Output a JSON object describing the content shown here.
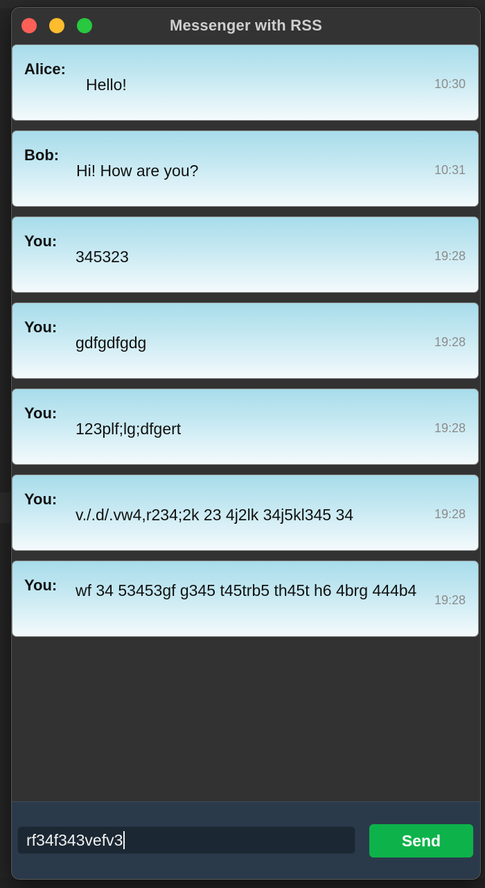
{
  "window": {
    "title": "Messenger with RSS"
  },
  "messages": [
    {
      "sender": "Alice:",
      "text": "Hello!",
      "time": "10:30"
    },
    {
      "sender": "Bob:",
      "text": "Hi! How are you?",
      "time": "10:31"
    },
    {
      "sender": "You:",
      "text": "345323",
      "time": "19:28"
    },
    {
      "sender": "You:",
      "text": "gdfgdfgdg",
      "time": "19:28"
    },
    {
      "sender": "You:",
      "text": "123plf;lg;dfgert",
      "time": "19:28"
    },
    {
      "sender": "You:",
      "text": "v./.d/.vw4,r234;2k 23 4j2lk 34j5kl345 34",
      "time": "19:28"
    },
    {
      "sender": "You:",
      "text": "wf 34 53453gf g345 t45trb5 th45t h6 4brg 444b4",
      "time": "19:28"
    }
  ],
  "composer": {
    "value": "rf34f343vefv3",
    "send_label": "Send"
  },
  "colors": {
    "send_button": "#0db34a",
    "bubble_top": "#a7dcea",
    "bubble_bottom": "#f4fafc",
    "input_bar": "#2b3a4a"
  }
}
